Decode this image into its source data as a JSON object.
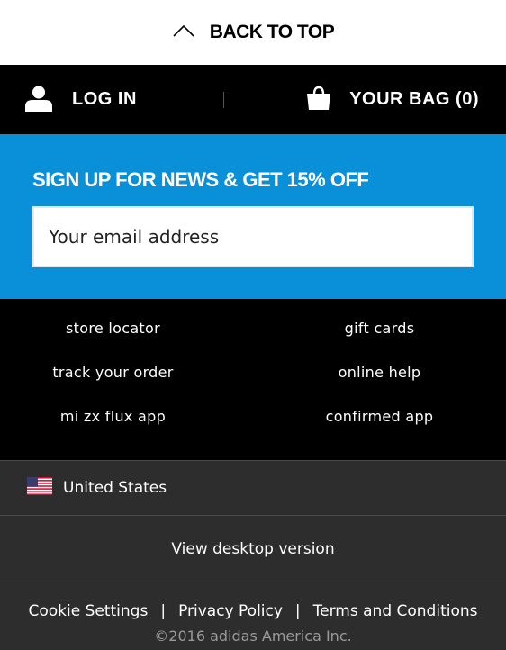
{
  "back_to_top": {
    "label": "BACK TO TOP"
  },
  "account_bar": {
    "login_label": "LOG IN",
    "bag_label": "YOUR BAG (0)"
  },
  "newsletter": {
    "title": "SIGN UP FOR NEWS & GET 15% OFF",
    "email_placeholder": "Your email address",
    "email_value": ""
  },
  "footer_links": [
    {
      "label": "store locator"
    },
    {
      "label": "gift cards"
    },
    {
      "label": "track your order"
    },
    {
      "label": "online help"
    },
    {
      "label": "mi zx flux app"
    },
    {
      "label": "confirmed app"
    }
  ],
  "country": {
    "label": "United States",
    "flag": "us-flag-icon"
  },
  "desktop_link": {
    "label": "View desktop version"
  },
  "legal": {
    "cookie_settings": "Cookie Settings",
    "privacy_policy": "Privacy Policy",
    "terms": "Terms and Conditions",
    "separator": "|",
    "copyright": "©2016 adidas America Inc."
  },
  "colors": {
    "accent_blue": "#0a8fd9",
    "bar_black": "#000000",
    "footer_gray": "#2d2d2d"
  }
}
